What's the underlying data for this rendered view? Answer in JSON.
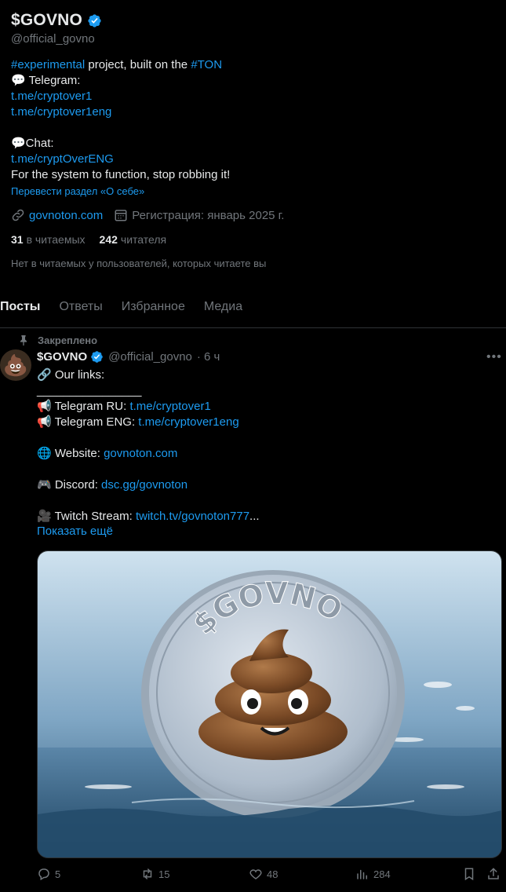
{
  "profile": {
    "display_name": "$GOVNO",
    "handle": "@official_govno",
    "bio": {
      "line1_tag": "#experimental",
      "line1_text": " project, built on the ",
      "line1_tag2": "#TON",
      "line2": "💬 Telegram:",
      "line3": "t.me/cryptover1",
      "line4": "t.me/cryptover1eng",
      "line6": "💬Chat:",
      "line7": "t.me/cryptOverENG",
      "line8": "For the system to function, stop robbing it!"
    },
    "translate_link": "Перевести раздел «О себе»",
    "website": "govnoton.com",
    "joined": "Регистрация: январь 2025 г.",
    "following_count": "31",
    "following_label": "в читаемых",
    "followers_count": "242",
    "followers_label": "читателя",
    "no_followers_note": "Нет в читаемых у пользователей, которых читаете вы"
  },
  "tabs": [
    "Посты",
    "Ответы",
    "Избранное",
    "Медиа"
  ],
  "tweet": {
    "pinned_label": "Закреплено",
    "author_name": "$GOVNO",
    "author_handle": "@official_govno",
    "time": "· 6 ч",
    "lines": {
      "l1": "🔗 Our links:",
      "l2": "________________",
      "l3_label": "📢 Telegram RU: ",
      "l3_link": "t.me/cryptover1",
      "l4_label": "📢 Telegram ENG: ",
      "l4_link": "t.me/cryptover1eng",
      "l6_label": "🌐 Website: ",
      "l6_link": "govnoton.com",
      "l8_label": "🎮 Discord: ",
      "l8_link": "dsc.gg/govnoton",
      "l10_label": "🎥 Twitch Stream: ",
      "l10_link": "twitch.tv/govnoton777",
      "l10_ellipsis": "..."
    },
    "show_more": "Показать ещё",
    "coin_text": "$GOVNO",
    "replies": "5",
    "reposts": "15",
    "likes": "48",
    "views": "284"
  },
  "colors": {
    "accent": "#1d9bf0",
    "background": "#000000",
    "text": "#e7e9ea",
    "muted": "#71767b"
  }
}
